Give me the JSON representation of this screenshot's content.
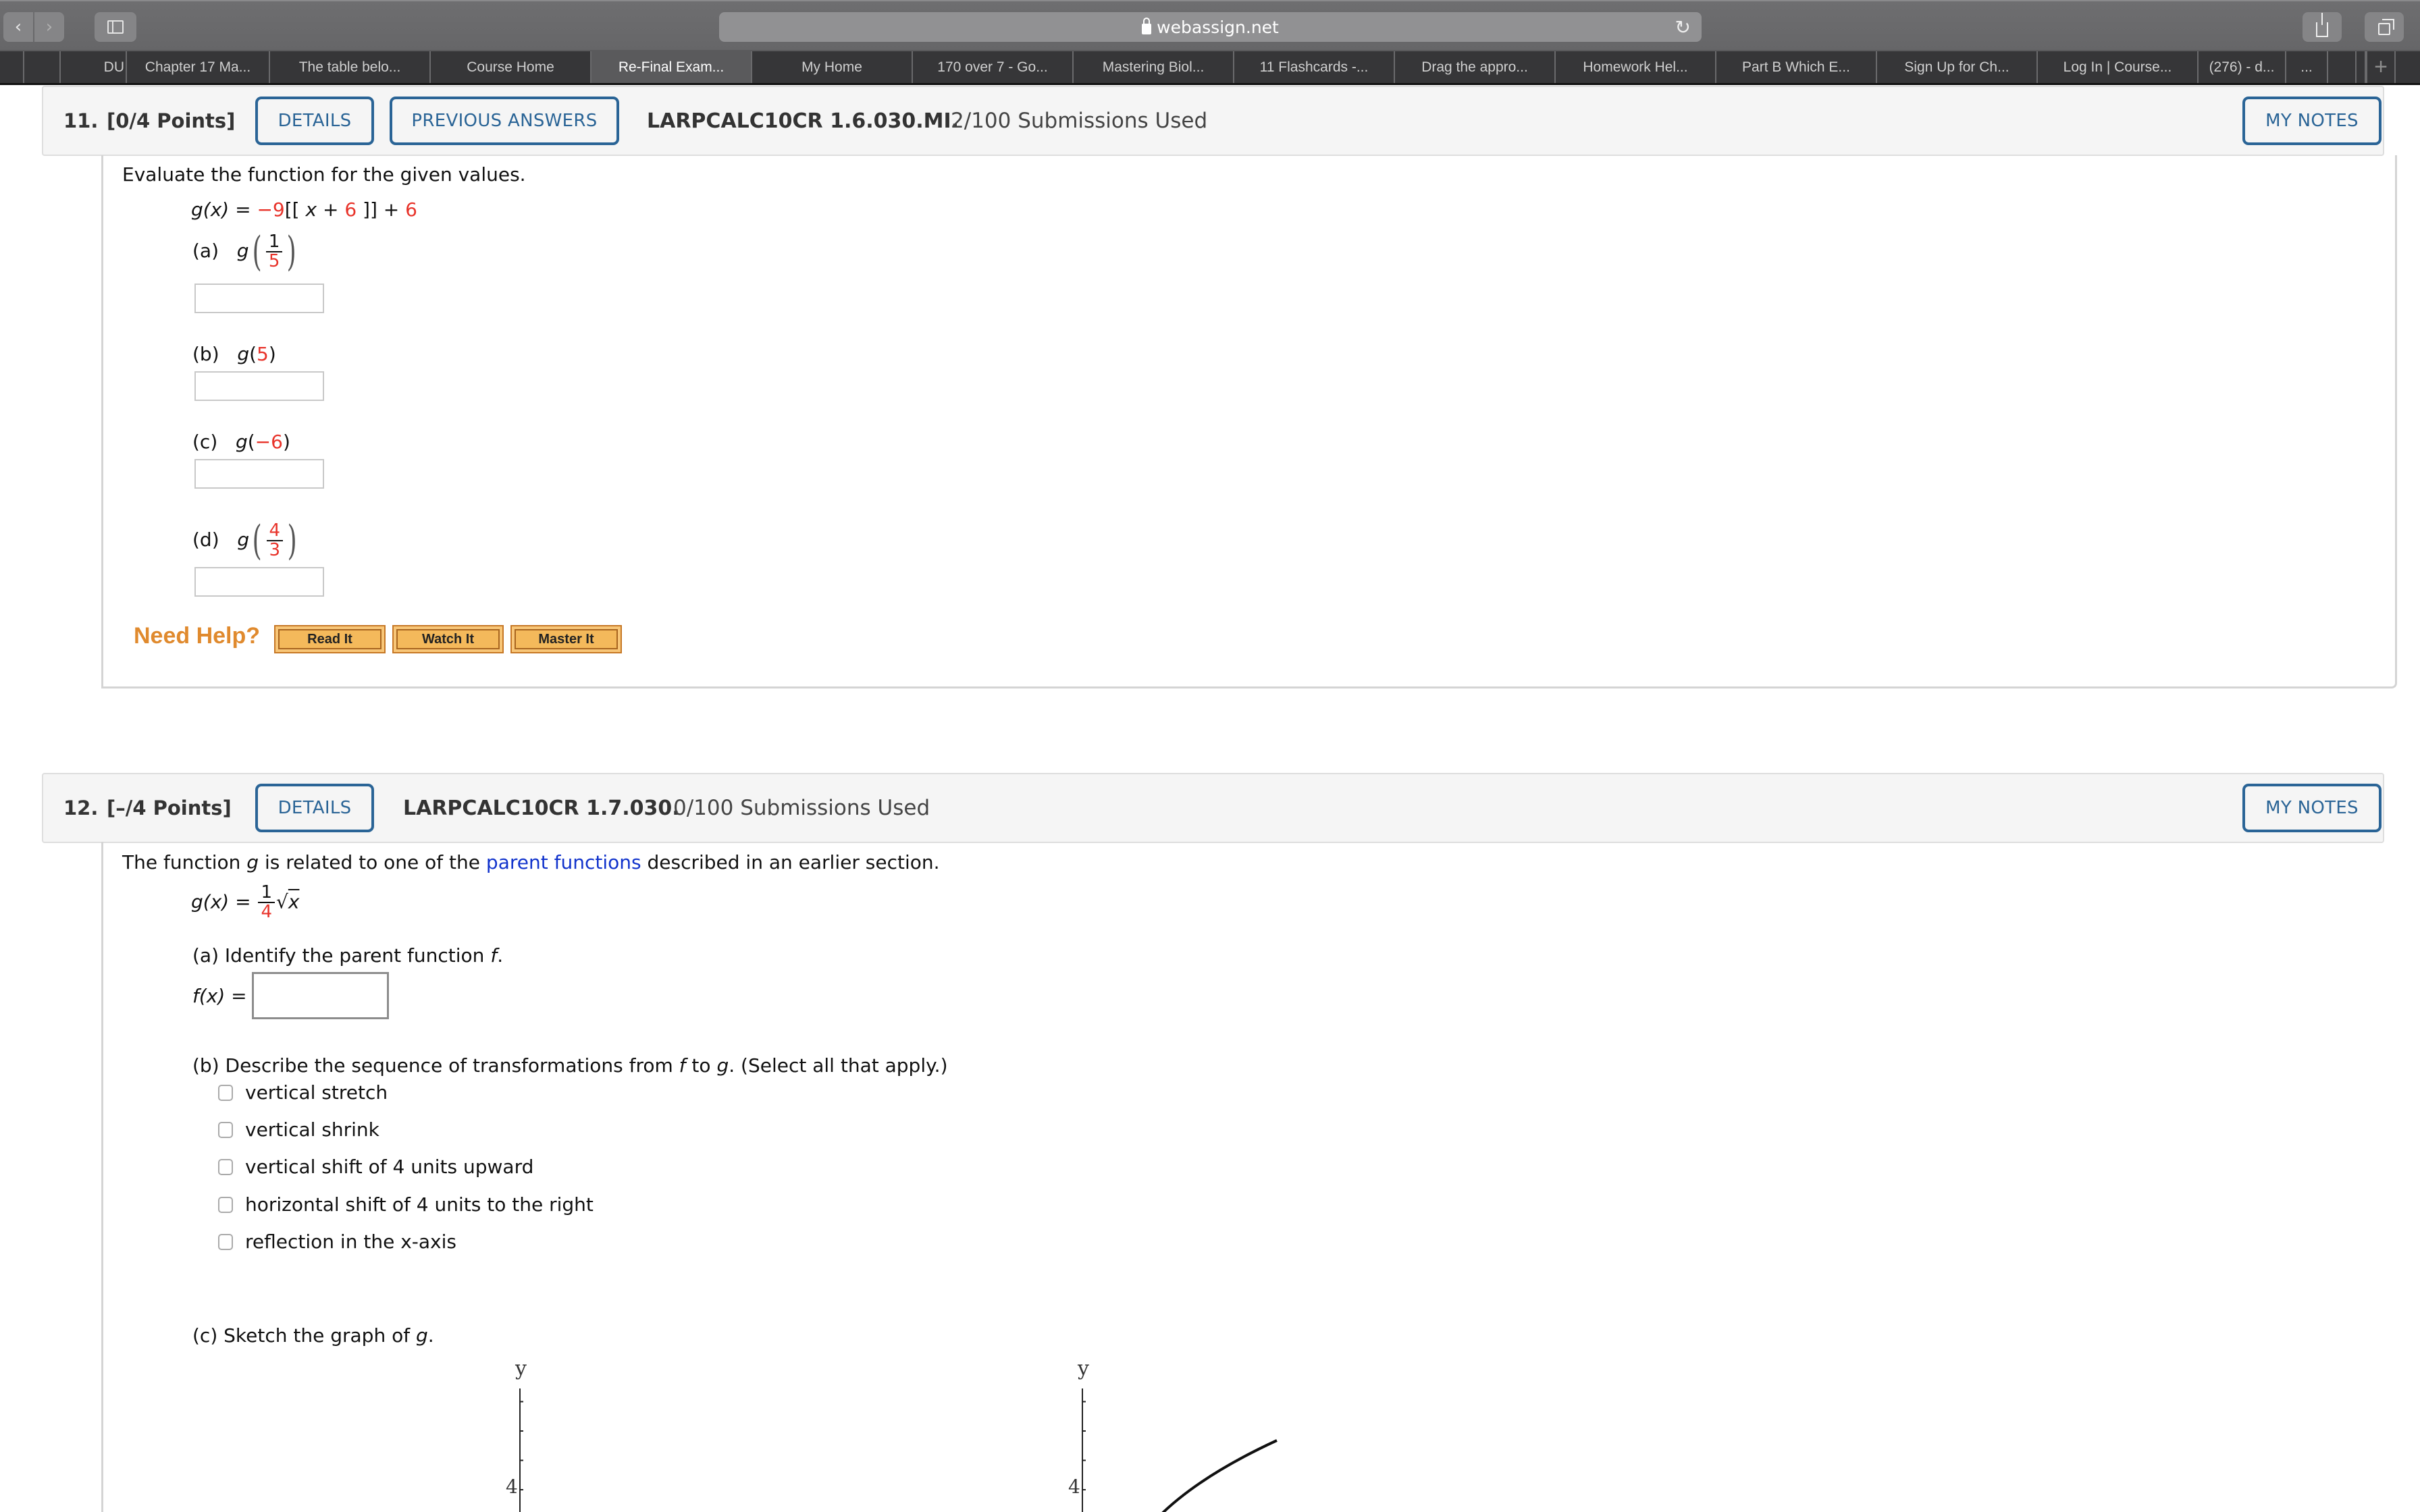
{
  "browser": {
    "url": "webassign.net",
    "icons": {
      "back": "chevron-left-icon",
      "forward": "chevron-right-icon",
      "sidebar": "sidebar-icon",
      "lock": "lock-icon",
      "reload": "reload-icon",
      "share": "share-icon",
      "tabs": "tab-overview-icon",
      "new_tab": "plus-icon"
    },
    "tabs": [
      {
        "label": ""
      },
      {
        "label": ""
      },
      {
        "label": "DU"
      },
      {
        "label": "Chapter 17 Ma..."
      },
      {
        "label": "The table belo..."
      },
      {
        "label": "Course Home"
      },
      {
        "label": "Re-Final Exam...",
        "active": true
      },
      {
        "label": "My Home"
      },
      {
        "label": "170 over 7 - Go..."
      },
      {
        "label": "Mastering Biol..."
      },
      {
        "label": "11 Flashcards -..."
      },
      {
        "label": "Drag the appro..."
      },
      {
        "label": "Homework Hel..."
      },
      {
        "label": "Part B Which E..."
      },
      {
        "label": "Sign Up for Ch..."
      },
      {
        "label": "Log In | Course..."
      },
      {
        "label": "(276) - d..."
      },
      {
        "label": "..."
      },
      {
        "label": ""
      },
      {
        "label": ""
      }
    ],
    "new_tab_label": "+"
  },
  "q11": {
    "number": "11.",
    "points": "[0/4 Points]",
    "details_label": "DETAILS",
    "previous_answers_label": "PREVIOUS ANSWERS",
    "code": "LARPCALC10CR 1.6.030.MI.",
    "submissions": "2/100 Submissions Used",
    "my_notes_label": "MY NOTES",
    "prompt": "Evaluate the function for the given values.",
    "function": {
      "lhs": "g(x) = ",
      "coef": "−9",
      "open": "[[",
      "var": " x + ",
      "inner_const": "6",
      "close": " ]]",
      "plus": " + ",
      "outer_const": "6"
    },
    "parts": [
      {
        "label": "(a)",
        "fn": "g",
        "arg_num": "1",
        "arg_den": "5",
        "type": "fraction",
        "answer": ""
      },
      {
        "label": "(b)",
        "fn": "g",
        "arg": "5",
        "type": "plain",
        "answer": ""
      },
      {
        "label": "(c)",
        "fn": "g",
        "arg": "−6",
        "type": "plain",
        "answer": ""
      },
      {
        "label": "(d)",
        "fn": "g",
        "arg_num": "4",
        "arg_den": "3",
        "type": "fraction",
        "answer": ""
      }
    ],
    "help": {
      "label": "Need Help?",
      "buttons": [
        "Read It",
        "Watch It",
        "Master It"
      ]
    }
  },
  "q12": {
    "number": "12.",
    "points": "[–/4 Points]",
    "details_label": "DETAILS",
    "code": "LARPCALC10CR 1.7.030.",
    "submissions": "0/100 Submissions Used",
    "my_notes_label": "MY NOTES",
    "prompt_pre": "The function ",
    "prompt_var": "g",
    "prompt_mid": " is related to one of the ",
    "prompt_link": "parent functions",
    "prompt_post": " described in an earlier section.",
    "function": {
      "lhs": "g(x) = ",
      "num": "1",
      "den": "4",
      "radical": "√",
      "radicand": "x"
    },
    "part_a": {
      "label": "(a) Identify the parent function ",
      "var": "f",
      "end": ".",
      "input_label": "f(x) = ",
      "answer": ""
    },
    "part_b": {
      "label_pre": "(b) Describe the sequence of transformations from ",
      "f": "f",
      "to": " to ",
      "g": "g",
      "label_post": ". (Select all that apply.)",
      "options": [
        {
          "label": "vertical stretch",
          "checked": false
        },
        {
          "label": "vertical shrink",
          "checked": false
        },
        {
          "label": "vertical shift of 4 units upward",
          "checked": false
        },
        {
          "label": "horizontal shift of 4 units to the right",
          "checked": false
        },
        {
          "label": "reflection in the x-axis",
          "checked": false
        }
      ]
    },
    "part_c": {
      "label_pre": "(c) Sketch the graph of ",
      "var": "g",
      "end": "."
    },
    "graphs": [
      {
        "y_label": "y",
        "tick_label": "4",
        "has_curve": false
      },
      {
        "y_label": "y",
        "tick_label": "4",
        "has_curve": true
      }
    ]
  }
}
